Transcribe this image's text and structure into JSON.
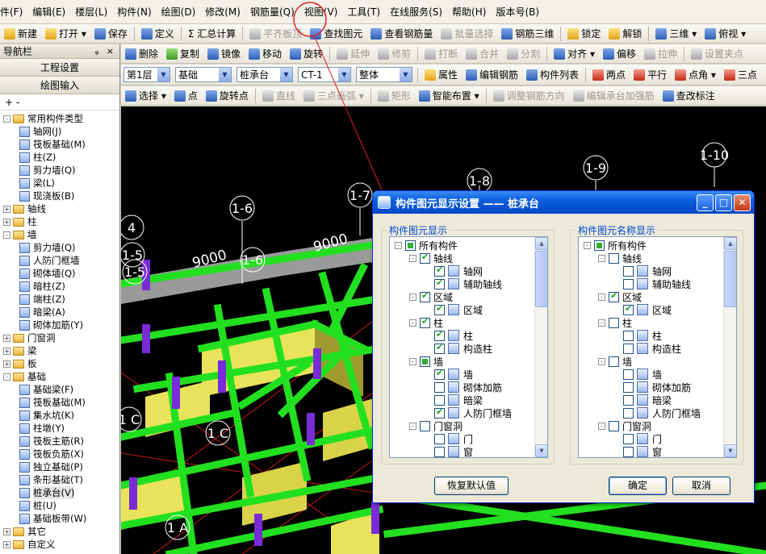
{
  "menu": [
    "件(F)",
    "编辑(E)",
    "楼层(L)",
    "构件(N)",
    "绘图(D)",
    "修改(M)",
    "钢筋量(Q)",
    "视图(V)",
    "工具(T)",
    "在线服务(S)",
    "帮助(H)",
    "版本号(B)"
  ],
  "toolbar1": [
    {
      "label": "新建",
      "icon": "new-file-icon",
      "color": "yel"
    },
    {
      "label": "打开 ▾",
      "icon": "open-folder-icon",
      "color": "yel"
    },
    {
      "label": "保存",
      "icon": "save-icon",
      "color": "blue"
    },
    {
      "label": "定义",
      "icon": "define-icon",
      "color": "blue"
    },
    {
      "label": "Σ 汇总计算",
      "icon": "",
      "color": ""
    },
    {
      "label": "平齐板顶",
      "icon": "align-slab-icon",
      "color": "gray",
      "disabled": true
    },
    {
      "label": "查找图元",
      "icon": "find-element-icon",
      "color": "blue"
    },
    {
      "label": "查看钢筋量",
      "icon": "view-rebar-icon",
      "color": "blue"
    },
    {
      "label": "批量选择",
      "icon": "batch-select-icon",
      "color": "gray",
      "disabled": true
    },
    {
      "label": "钢筋三维",
      "icon": "rebar-3d-icon",
      "color": "blue"
    },
    {
      "label": "锁定",
      "icon": "lock-icon",
      "color": "yel"
    },
    {
      "label": "解锁",
      "icon": "unlock-icon",
      "color": "yel"
    },
    {
      "label": "三维 ▾",
      "icon": "cube-3d-icon",
      "color": "blue"
    },
    {
      "label": "俯视 ▾",
      "icon": "top-view-icon",
      "color": "blue"
    }
  ],
  "toolbar2": [
    {
      "label": "删除",
      "icon": "delete-icon",
      "color": "blue"
    },
    {
      "label": "复制",
      "icon": "copy-icon",
      "color": "grn"
    },
    {
      "label": "镜像",
      "icon": "mirror-icon",
      "color": "blue"
    },
    {
      "label": "移动",
      "icon": "move-icon",
      "color": "blue"
    },
    {
      "label": "旋转",
      "icon": "rotate-icon",
      "color": "blue"
    },
    {
      "label": "延伸",
      "icon": "extend-icon",
      "color": "gray",
      "disabled": true
    },
    {
      "label": "修剪",
      "icon": "trim-icon",
      "color": "gray",
      "disabled": true
    },
    {
      "label": "打断",
      "icon": "break-icon",
      "color": "gray",
      "disabled": true
    },
    {
      "label": "合并",
      "icon": "merge-icon",
      "color": "gray",
      "disabled": true
    },
    {
      "label": "分割",
      "icon": "split-icon",
      "color": "gray",
      "disabled": true
    },
    {
      "label": "对齐 ▾",
      "icon": "align-icon",
      "color": "blue"
    },
    {
      "label": "偏移",
      "icon": "offset-icon",
      "color": "blue"
    },
    {
      "label": "拉伸",
      "icon": "stretch-icon",
      "color": "gray",
      "disabled": true
    },
    {
      "label": "设置夹点",
      "icon": "grip-icon",
      "color": "gray",
      "disabled": true
    }
  ],
  "toolbar3": {
    "floor": "第1层",
    "category": "基础",
    "type": "桩承台",
    "instance": "CT-1",
    "scope": "整体",
    "buttons": [
      {
        "label": "属性",
        "icon": "properties-icon",
        "color": "yel"
      },
      {
        "label": "编辑钢筋",
        "icon": "edit-rebar-icon",
        "color": "blue"
      },
      {
        "label": "构件列表",
        "icon": "element-list-icon",
        "color": "blue"
      },
      {
        "label": "两点",
        "icon": "two-point-icon",
        "color": "red"
      },
      {
        "label": "平行",
        "icon": "parallel-icon",
        "color": "red"
      },
      {
        "label": "点角 ▾",
        "icon": "point-angle-icon",
        "color": "red"
      },
      {
        "label": "三点",
        "icon": "three-point-icon",
        "color": "red"
      }
    ]
  },
  "toolbar4": [
    {
      "label": "选择 ▾",
      "icon": "select-cursor-icon",
      "color": "blue"
    },
    {
      "label": "点",
      "icon": "point-icon",
      "color": "blue"
    },
    {
      "label": "旋转点",
      "icon": "rotate-point-icon",
      "color": "blue"
    },
    {
      "label": "直线",
      "icon": "line-icon",
      "color": "gray",
      "disabled": true
    },
    {
      "label": "三点画弧 ▾",
      "icon": "arc-icon",
      "color": "gray",
      "disabled": true
    },
    {
      "label": "矩形",
      "icon": "rectangle-icon",
      "color": "gray",
      "disabled": true
    },
    {
      "label": "智能布置 ▾",
      "icon": "smart-layout-icon",
      "color": "blue"
    },
    {
      "label": "调整钢筋方向",
      "icon": "adjust-rebar-icon",
      "color": "gray",
      "disabled": true
    },
    {
      "label": "编辑承台加强筋",
      "icon": "cap-rebar-icon",
      "color": "gray",
      "disabled": true
    },
    {
      "label": "查改标注",
      "icon": "annotation-icon",
      "color": "blue"
    }
  ],
  "nav": {
    "title": "导航栏",
    "pin_glyphs": "ᵩ ×",
    "project_settings": "工程设置",
    "drawing_input": "绘图输入",
    "tools_row": "+ -",
    "tree": [
      {
        "label": "常用构件类型",
        "level": 0,
        "expanded": true
      },
      {
        "label": "轴网(J)",
        "level": 1
      },
      {
        "label": "筏板基础(M)",
        "level": 1
      },
      {
        "label": "柱(Z)",
        "level": 1
      },
      {
        "label": "剪力墙(Q)",
        "level": 1
      },
      {
        "label": "梁(L)",
        "level": 1
      },
      {
        "label": "现浇板(B)",
        "level": 1
      },
      {
        "label": "轴线",
        "level": 0,
        "expanded": false
      },
      {
        "label": "柱",
        "level": 0,
        "expanded": false
      },
      {
        "label": "墙",
        "level": 0,
        "expanded": true
      },
      {
        "label": "剪力墙(Q)",
        "level": 1
      },
      {
        "label": "人防门框墙",
        "level": 1
      },
      {
        "label": "砌体墙(Q)",
        "level": 1
      },
      {
        "label": "暗柱(Z)",
        "level": 1
      },
      {
        "label": "端柱(Z)",
        "level": 1
      },
      {
        "label": "暗梁(A)",
        "level": 1
      },
      {
        "label": "砌体加筋(Y)",
        "level": 1
      },
      {
        "label": "门窗洞",
        "level": 0,
        "expanded": false
      },
      {
        "label": "梁",
        "level": 0,
        "expanded": false
      },
      {
        "label": "板",
        "level": 0,
        "expanded": false
      },
      {
        "label": "基础",
        "level": 0,
        "expanded": true
      },
      {
        "label": "基础梁(F)",
        "level": 1
      },
      {
        "label": "筏板基础(M)",
        "level": 1
      },
      {
        "label": "集水坑(K)",
        "level": 1
      },
      {
        "label": "柱墩(Y)",
        "level": 1
      },
      {
        "label": "筏板主筋(R)",
        "level": 1
      },
      {
        "label": "筏板负筋(X)",
        "level": 1
      },
      {
        "label": "独立基础(P)",
        "level": 1
      },
      {
        "label": "条形基础(T)",
        "level": 1
      },
      {
        "label": "桩承台(V)",
        "level": 1,
        "selected": true
      },
      {
        "label": "桩(U)",
        "level": 1
      },
      {
        "label": "基础板带(W)",
        "level": 1
      },
      {
        "label": "其它",
        "level": 0,
        "expanded": false
      },
      {
        "label": "自定义",
        "level": 0,
        "expanded": false
      }
    ]
  },
  "viewport": {
    "axis_labels": [
      "4",
      "1-5",
      "1-5",
      "1-6",
      "1-6",
      "1-7",
      "1-8",
      "1-9",
      "1-10",
      "1 C",
      "1 C",
      "1 A"
    ],
    "dimensions": [
      "9000",
      "9000"
    ]
  },
  "dialog": {
    "title": "构件图元显示设置 —— 桩承台",
    "left_group": "构件图元显示",
    "right_group": "构件图元名称显示",
    "restore_button": "恢复默认值",
    "ok_button": "确定",
    "cancel_button": "取消",
    "left_items": [
      {
        "label": "所有构件",
        "level": 0,
        "check": "part",
        "exp": "-"
      },
      {
        "label": "轴线",
        "level": 1,
        "check": "on",
        "exp": "-"
      },
      {
        "label": "轴网",
        "level": 2,
        "check": "on",
        "icon": "grid-icon"
      },
      {
        "label": "辅助轴线",
        "level": 2,
        "check": "on",
        "icon": "aux-axis-icon"
      },
      {
        "label": "区域",
        "level": 1,
        "check": "on",
        "exp": "-"
      },
      {
        "label": "区域",
        "level": 2,
        "check": "on",
        "icon": "region-icon"
      },
      {
        "label": "柱",
        "level": 1,
        "check": "on",
        "exp": "-"
      },
      {
        "label": "柱",
        "level": 2,
        "check": "on",
        "icon": "column-icon"
      },
      {
        "label": "构造柱",
        "level": 2,
        "check": "on",
        "icon": "constructional-column-icon"
      },
      {
        "label": "墙",
        "level": 1,
        "check": "part",
        "exp": "-"
      },
      {
        "label": "墙",
        "level": 2,
        "check": "on",
        "icon": "wall-icon"
      },
      {
        "label": "砌体加筋",
        "level": 2,
        "check": "off",
        "icon": "masonry-rebar-icon"
      },
      {
        "label": "暗梁",
        "level": 2,
        "check": "off",
        "icon": "hidden-beam-icon"
      },
      {
        "label": "人防门框墙",
        "level": 2,
        "check": "on",
        "icon": "civil-defense-wall-icon"
      },
      {
        "label": "门窗洞",
        "level": 1,
        "check": "off",
        "exp": "-"
      },
      {
        "label": "门",
        "level": 2,
        "check": "off",
        "icon": "door-icon"
      },
      {
        "label": "窗",
        "level": 2,
        "check": "off",
        "icon": "window-icon"
      }
    ],
    "right_items": [
      {
        "label": "所有构件",
        "level": 0,
        "check": "part",
        "exp": "-"
      },
      {
        "label": "轴线",
        "level": 1,
        "check": "off",
        "exp": "-"
      },
      {
        "label": "轴网",
        "level": 2,
        "check": "off",
        "icon": "grid-icon"
      },
      {
        "label": "辅助轴线",
        "level": 2,
        "check": "off",
        "icon": "aux-axis-icon"
      },
      {
        "label": "区域",
        "level": 1,
        "check": "on",
        "exp": "-"
      },
      {
        "label": "区域",
        "level": 2,
        "check": "on",
        "icon": "region-icon"
      },
      {
        "label": "柱",
        "level": 1,
        "check": "off",
        "exp": "-"
      },
      {
        "label": "柱",
        "level": 2,
        "check": "off",
        "icon": "column-icon"
      },
      {
        "label": "构造柱",
        "level": 2,
        "check": "off",
        "icon": "constructional-column-icon"
      },
      {
        "label": "墙",
        "level": 1,
        "check": "off",
        "exp": "-"
      },
      {
        "label": "墙",
        "level": 2,
        "check": "off",
        "icon": "wall-icon"
      },
      {
        "label": "砌体加筋",
        "level": 2,
        "check": "off",
        "icon": "masonry-rebar-icon"
      },
      {
        "label": "暗梁",
        "level": 2,
        "check": "off",
        "icon": "hidden-beam-icon"
      },
      {
        "label": "人防门框墙",
        "level": 2,
        "check": "off",
        "icon": "civil-defense-wall-icon"
      },
      {
        "label": "门窗洞",
        "level": 1,
        "check": "off",
        "exp": "-"
      },
      {
        "label": "门",
        "level": 2,
        "check": "off",
        "icon": "door-icon"
      },
      {
        "label": "窗",
        "level": 2,
        "check": "off",
        "icon": "window-icon"
      }
    ]
  },
  "colors": {
    "beam": "#22e01f",
    "wall_top": "#e8e35a",
    "wall_side": "#9e9a2e",
    "column": "#7a2bd8",
    "axis": "#ffffff",
    "highlight_circle": "#e02020"
  }
}
